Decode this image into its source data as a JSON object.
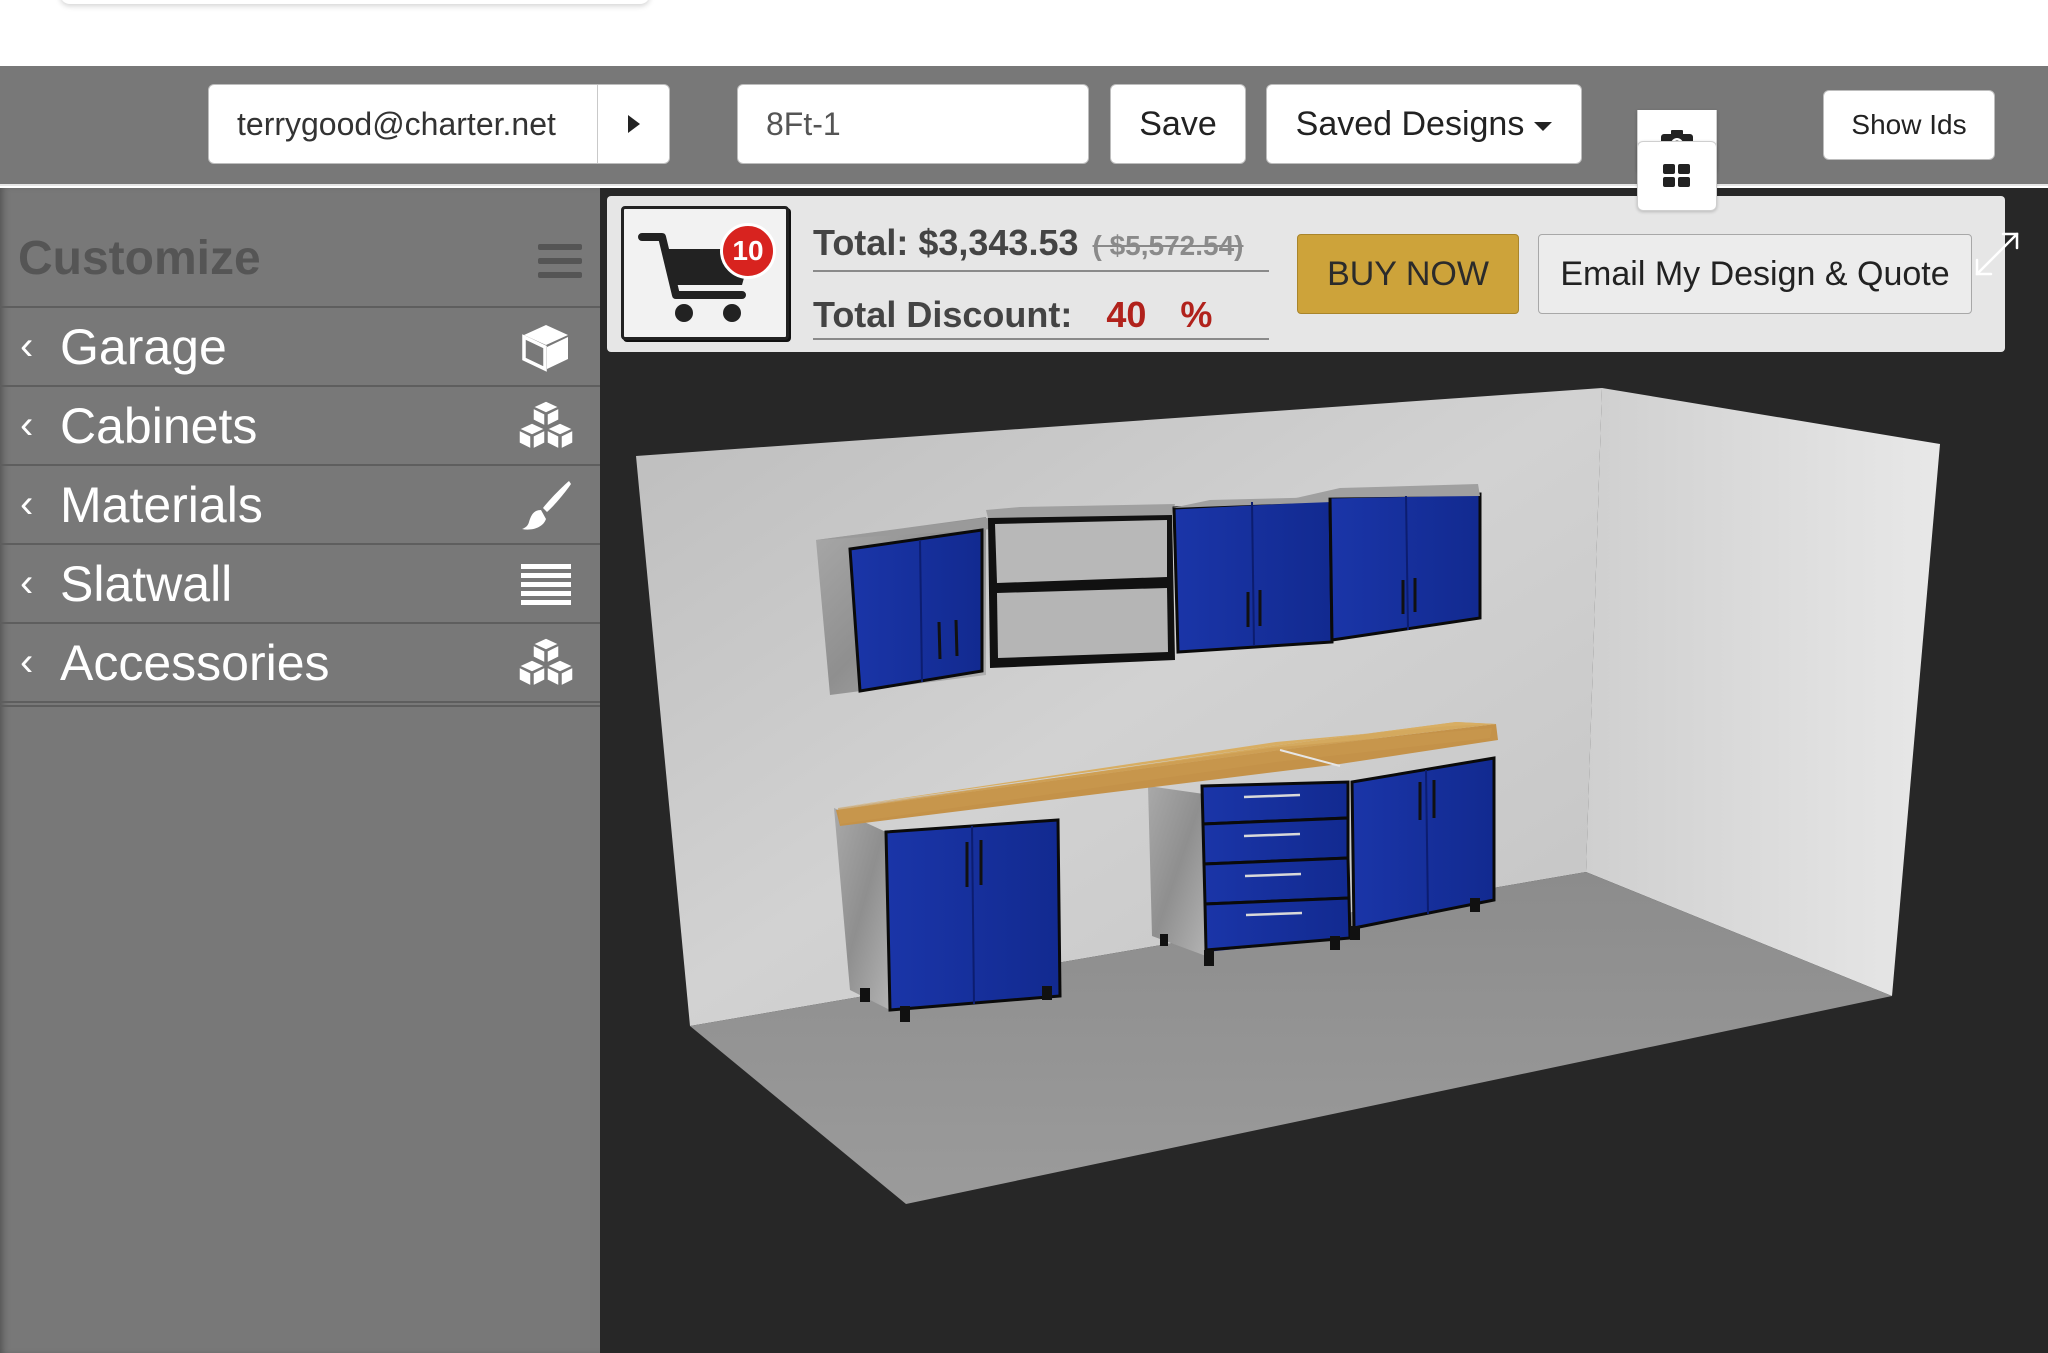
{
  "toolbar": {
    "email": "terrygood@charter.net",
    "design_name": "8Ft-1",
    "save_label": "Save",
    "saved_designs_label": "Saved Designs",
    "show_ids_label": "Show Ids"
  },
  "sidebar": {
    "title": "Customize",
    "items": [
      {
        "label": "Garage",
        "icon": "cube-icon"
      },
      {
        "label": "Cabinets",
        "icon": "cubes-icon"
      },
      {
        "label": "Materials",
        "icon": "paintbrush-icon"
      },
      {
        "label": "Slatwall",
        "icon": "slatwall-lines-icon"
      },
      {
        "label": "Accessories",
        "icon": "cubes-icon"
      }
    ]
  },
  "quote": {
    "cart_count": "10",
    "total_label": "Total:",
    "total": "$3,343.53",
    "original_total": "( $5,572.54)",
    "discount_label": "Total Discount:",
    "discount_value": "40",
    "discount_unit": "%",
    "buy_now_label": "BUY NOW",
    "email_quote_label": "Email My Design & Quote"
  },
  "colors": {
    "toolbar_bg": "#787878",
    "viewport_bg": "#272727",
    "buy_now": "#cda33a",
    "badge": "#d8231f",
    "discount": "#b1221c",
    "cabinet_blue": "#1530a0",
    "countertop": "#d4a95e"
  }
}
